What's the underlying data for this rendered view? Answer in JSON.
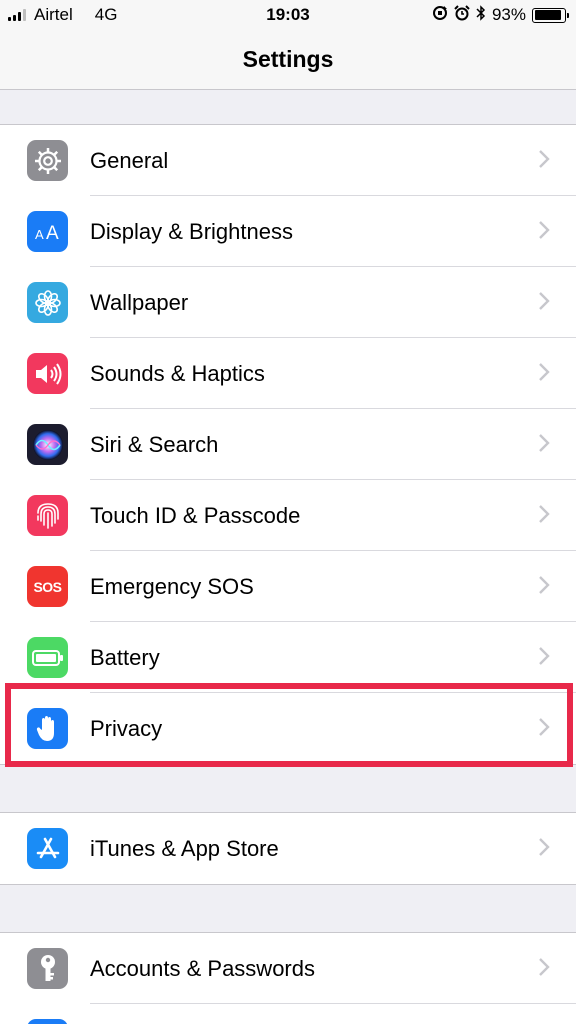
{
  "status_bar": {
    "carrier": "Airtel",
    "network": "4G",
    "time": "19:03",
    "battery_percent": "93%",
    "battery_level": 0.93,
    "icons": [
      "signal-icon",
      "orientation-lock-icon",
      "alarm-icon",
      "bluetooth-icon",
      "battery-icon"
    ]
  },
  "nav": {
    "title": "Settings"
  },
  "groups": [
    {
      "items": [
        {
          "label": "General",
          "icon": "gear-icon",
          "color": "#8e8e93"
        },
        {
          "label": "Display & Brightness",
          "icon": "text-size-icon",
          "color": "#1a7cf6"
        },
        {
          "label": "Wallpaper",
          "icon": "flower-icon",
          "color": "#35a9e0"
        },
        {
          "label": "Sounds & Haptics",
          "icon": "speaker-icon",
          "color": "#f2385e"
        },
        {
          "label": "Siri & Search",
          "icon": "siri-icon",
          "color": "#1c1c2e"
        },
        {
          "label": "Touch ID & Passcode",
          "icon": "fingerprint-icon",
          "color": "#f2385e"
        },
        {
          "label": "Emergency SOS",
          "icon": "sos-icon",
          "icon_text": "SOS",
          "color": "#f0352f"
        },
        {
          "label": "Battery",
          "icon": "battery-icon",
          "color": "#4cd964"
        },
        {
          "label": "Privacy",
          "icon": "hand-icon",
          "color": "#1a7cf6",
          "highlighted": true
        }
      ]
    },
    {
      "items": [
        {
          "label": "iTunes & App Store",
          "icon": "app-store-icon",
          "color": "#1a8cf6"
        }
      ]
    },
    {
      "items": [
        {
          "label": "Accounts & Passwords",
          "icon": "key-icon",
          "color": "#8e8e93"
        }
      ]
    }
  ],
  "highlight_color": "#e8294a"
}
